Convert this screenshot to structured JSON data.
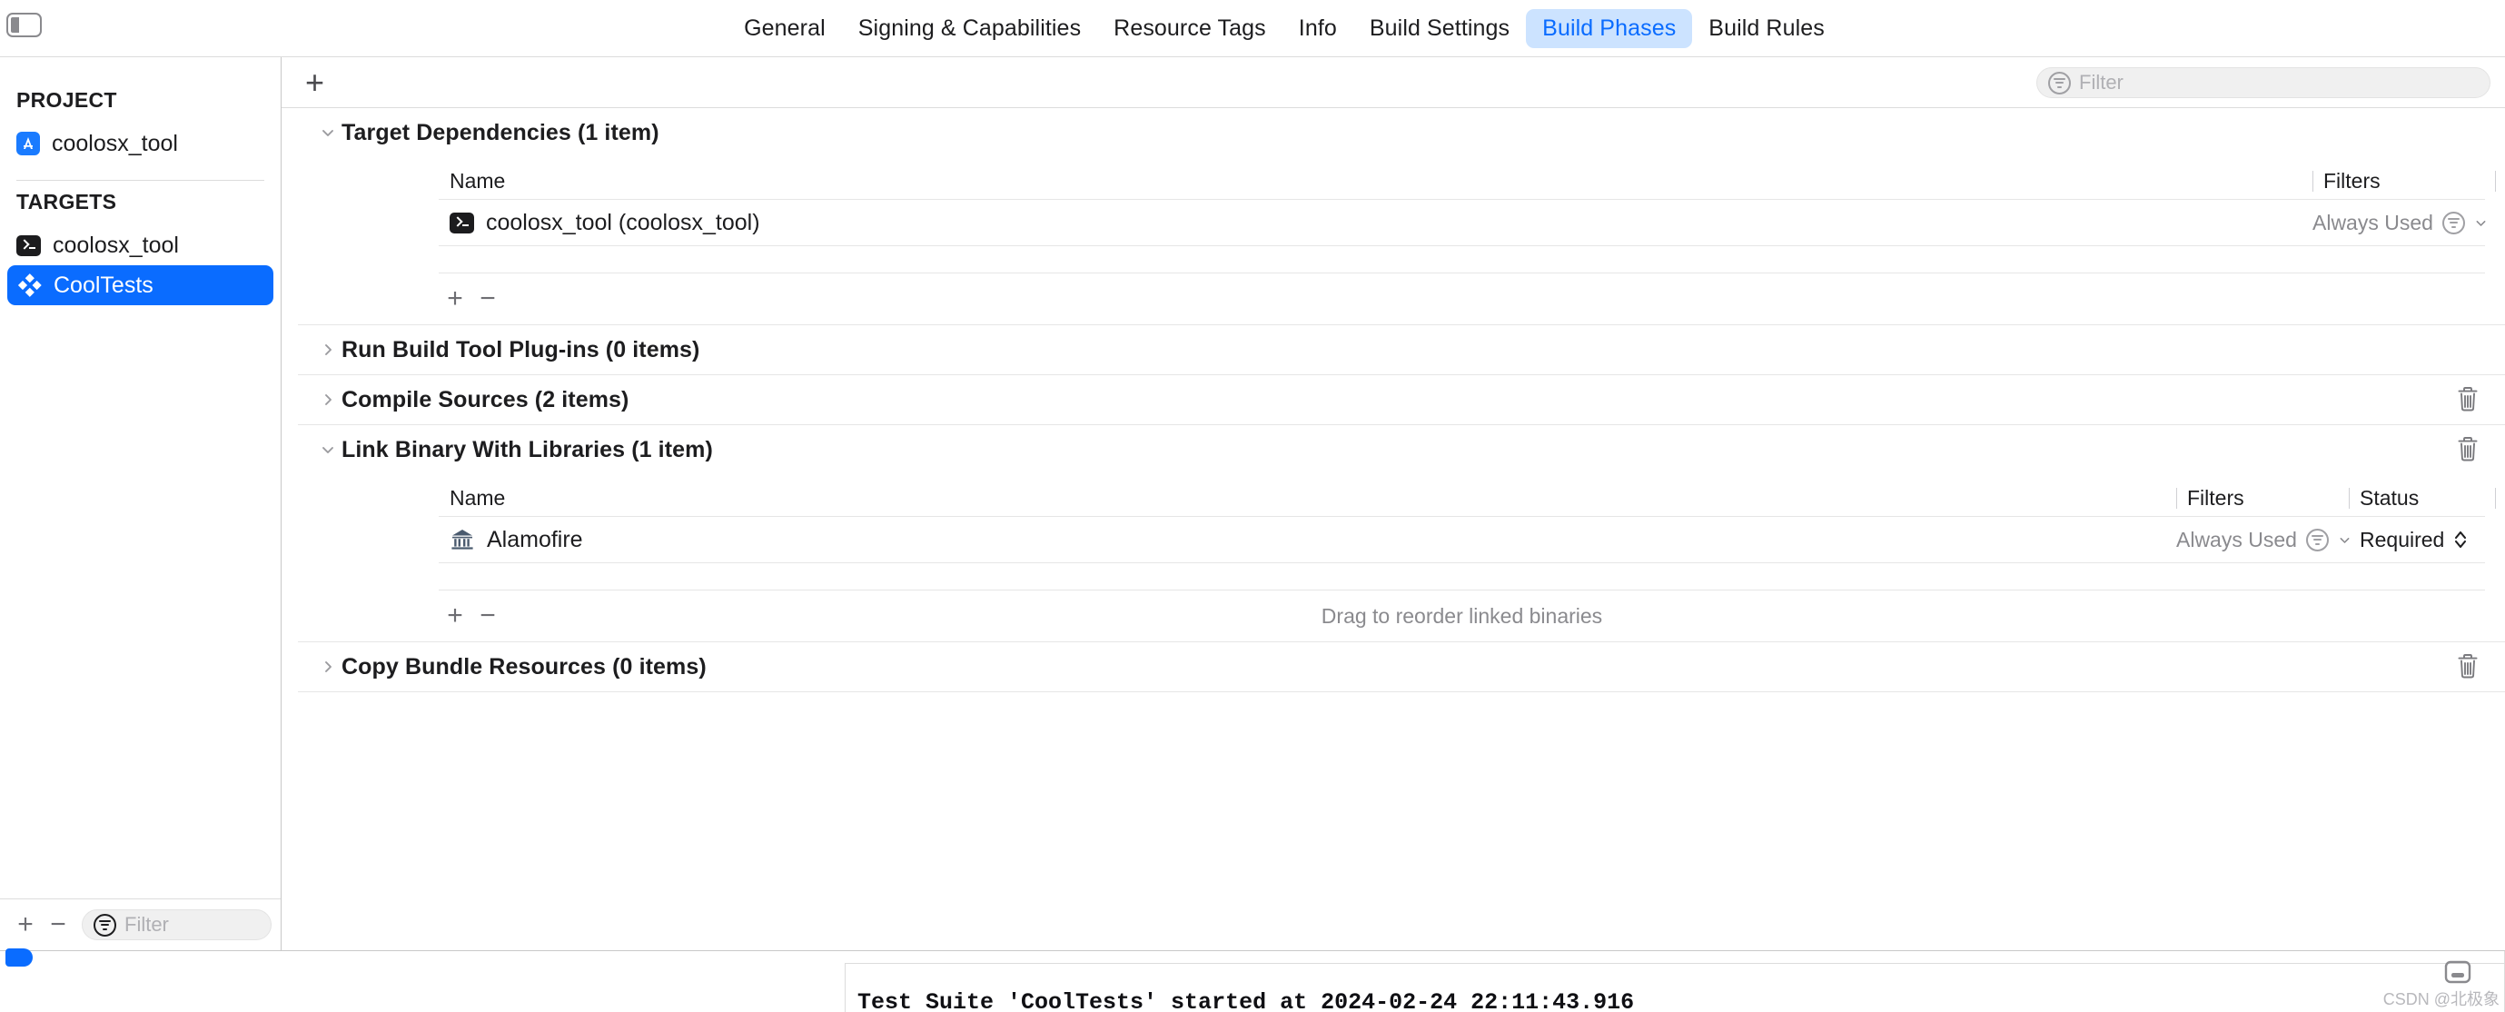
{
  "window": {
    "sidebar_toggle_icon": "sidebar-toggle-icon"
  },
  "tabs": [
    {
      "label": "General",
      "active": false
    },
    {
      "label": "Signing & Capabilities",
      "active": false
    },
    {
      "label": "Resource Tags",
      "active": false
    },
    {
      "label": "Info",
      "active": false
    },
    {
      "label": "Build Settings",
      "active": false
    },
    {
      "label": "Build Phases",
      "active": true
    },
    {
      "label": "Build Rules",
      "active": false
    }
  ],
  "sidebar": {
    "project_group_label": "PROJECT",
    "project_items": [
      {
        "label": "coolosx_tool",
        "icon": "appstore-icon",
        "selected": false
      }
    ],
    "targets_group_label": "TARGETS",
    "target_items": [
      {
        "label": "coolosx_tool",
        "icon": "terminal-icon",
        "selected": false
      },
      {
        "label": "CoolTests",
        "icon": "test-bundle-icon",
        "selected": true
      }
    ],
    "footer": {
      "add_label": "+",
      "remove_label": "−",
      "filter_placeholder": "Filter",
      "filter_value": ""
    }
  },
  "toolbar": {
    "add_phase_label": "+",
    "filter_placeholder": "Filter",
    "filter_value": ""
  },
  "phases": [
    {
      "title": "Target Dependencies (1 item)",
      "expanded": true,
      "has_trash": false,
      "columns": [
        "Name",
        "Filters"
      ],
      "rows": [
        {
          "icon": "terminal-icon",
          "name": "coolosx_tool (coolosx_tool)",
          "filters": "Always Used",
          "status": null
        }
      ],
      "footer": {
        "add_label": "+",
        "remove_label": "−",
        "hint": ""
      }
    },
    {
      "title": "Run Build Tool Plug-ins (0 items)",
      "expanded": false,
      "has_trash": false,
      "columns": [],
      "rows": [],
      "footer": null
    },
    {
      "title": "Compile Sources (2 items)",
      "expanded": false,
      "has_trash": true,
      "columns": [],
      "rows": [],
      "footer": null
    },
    {
      "title": "Link Binary With Libraries (1 item)",
      "expanded": true,
      "has_trash": true,
      "columns": [
        "Name",
        "Filters",
        "Status"
      ],
      "rows": [
        {
          "icon": "library-icon",
          "name": "Alamofire",
          "filters": "Always Used",
          "status": "Required"
        }
      ],
      "footer": {
        "add_label": "+",
        "remove_label": "−",
        "hint": "Drag to reorder linked binaries"
      }
    },
    {
      "title": "Copy Bundle Resources (0 items)",
      "expanded": false,
      "has_trash": true,
      "columns": [],
      "rows": [],
      "footer": null
    }
  ],
  "console": {
    "log_line": "Test Suite 'CoolTests' started at 2024-02-24 22:11:43.916",
    "toggle_icon": "console-panel-icon",
    "watermark": "CSDN @北极象"
  },
  "colors": {
    "accent": "#0a6cff",
    "tab_active_bg": "#cce3ff",
    "selected_row_bg": "#0a6cff",
    "muted_text": "#8a8a8e",
    "border": "#dcdcdc",
    "library_icon": "#4a5a6e"
  }
}
